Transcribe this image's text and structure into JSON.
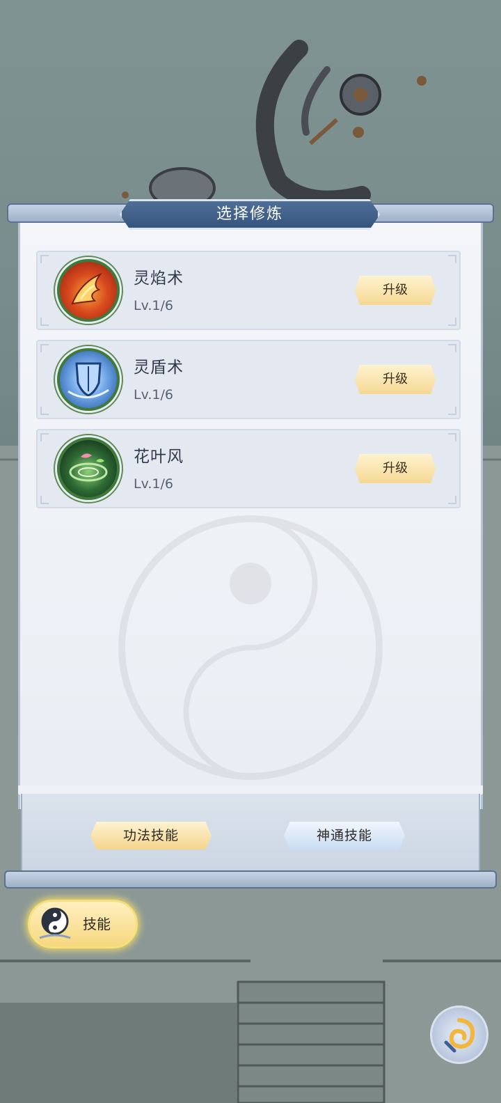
{
  "title": "选择修炼",
  "skills": [
    {
      "name": "灵焰术",
      "level": "Lv.1/6",
      "upgrade_label": "升级",
      "icon": "flame-icon"
    },
    {
      "name": "灵盾术",
      "level": "Lv.1/6",
      "upgrade_label": "升级",
      "icon": "shield-icon"
    },
    {
      "name": "花叶风",
      "level": "Lv.1/6",
      "upgrade_label": "升级",
      "icon": "leaf-wind-icon"
    }
  ],
  "tabs": [
    {
      "label": "功法技能"
    },
    {
      "label": "神通技能"
    }
  ],
  "skill_button": {
    "label": "技能",
    "icon": "yin-yang-icon"
  },
  "swirl_button": {
    "icon": "swirl-icon"
  },
  "colors": {
    "banner": "#3f5f8a",
    "upgrade": "#f6d894",
    "skill_button": "#f6d77f"
  }
}
